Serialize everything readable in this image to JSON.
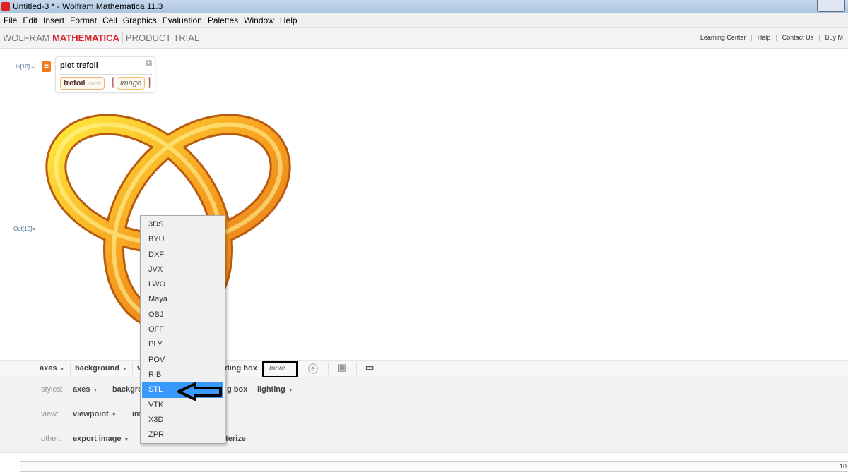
{
  "window": {
    "title": "Untitled-3 * - Wolfram Mathematica 11.3"
  },
  "menu": [
    "File",
    "Edit",
    "Insert",
    "Format",
    "Cell",
    "Graphics",
    "Evaluation",
    "Palettes",
    "Window",
    "Help"
  ],
  "brand": {
    "wolfram": "WOLFRAM",
    "mathematica": "MATHEMATICA",
    "trial": "PRODUCT TRIAL"
  },
  "links": [
    "Learning Center",
    "Help",
    "Contact Us",
    "Buy M"
  ],
  "cell": {
    "in_label": "In[10]:=",
    "out_label": "Out[10]=",
    "query": "plot trefoil",
    "token1": "trefoil",
    "token1_type": "KNOT",
    "token2": "image",
    "eq_button": "="
  },
  "toolbar": {
    "axes": "axes",
    "background": "background",
    "v": "v",
    "bounding": "ding box",
    "more": "more..."
  },
  "suggestions": {
    "styles_label": "styles:",
    "styles": [
      "axes",
      "backgro",
      "g box",
      "lighting"
    ],
    "view_label": "view:",
    "view": [
      "viewpoint",
      "im"
    ],
    "other_label": "other:",
    "other": [
      "export image",
      "sterize"
    ]
  },
  "dropdown": {
    "items": [
      "3DS",
      "BYU",
      "DXF",
      "JVX",
      "LWO",
      "Maya",
      "OBJ",
      "OFF",
      "PLY",
      "POV",
      "RIB",
      "STL",
      "VTK",
      "X3D",
      "ZPR"
    ],
    "selected": "STL"
  },
  "status": {
    "number": "10"
  },
  "colors": {
    "accent": "#d6242e",
    "selection": "#3a99ff",
    "knot": "#f5a020"
  }
}
